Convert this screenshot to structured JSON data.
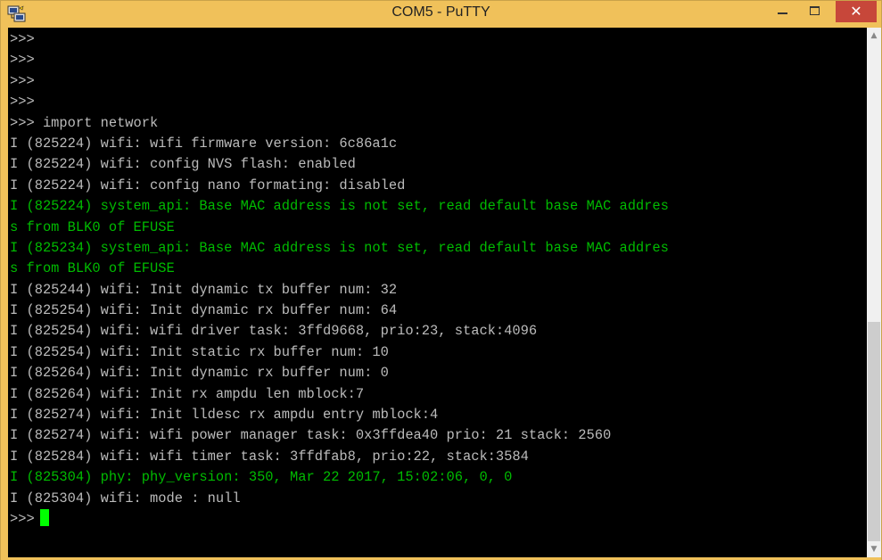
{
  "window": {
    "title": "COM5 - PuTTY",
    "icon": "putty-icon",
    "controls": {
      "minimize": "minimize-icon",
      "maximize": "maximize-icon",
      "close": "close-icon",
      "close_glyph": "✕"
    },
    "accent_color": "#f0c15a",
    "close_color": "#c7473a"
  },
  "terminal": {
    "background": "#000000",
    "text_color": "#bbbbbb",
    "info_color": "#00bb00",
    "cursor_color": "#00ff00",
    "lines": [
      {
        "text": ">>>",
        "color": "gray"
      },
      {
        "text": ">>>",
        "color": "gray"
      },
      {
        "text": ">>>",
        "color": "gray"
      },
      {
        "text": ">>>",
        "color": "gray"
      },
      {
        "text": ">>> import network",
        "color": "gray"
      },
      {
        "text": "I (825224) wifi: wifi firmware version: 6c86a1c",
        "color": "gray"
      },
      {
        "text": "I (825224) wifi: config NVS flash: enabled",
        "color": "gray"
      },
      {
        "text": "I (825224) wifi: config nano formating: disabled",
        "color": "gray"
      },
      {
        "text": "I (825224) system_api: Base MAC address is not set, read default base MAC addres",
        "color": "green"
      },
      {
        "text": "s from BLK0 of EFUSE",
        "color": "green"
      },
      {
        "text": "I (825234) system_api: Base MAC address is not set, read default base MAC addres",
        "color": "green"
      },
      {
        "text": "s from BLK0 of EFUSE",
        "color": "green"
      },
      {
        "text": "I (825244) wifi: Init dynamic tx buffer num: 32",
        "color": "gray"
      },
      {
        "text": "I (825254) wifi: Init dynamic rx buffer num: 64",
        "color": "gray"
      },
      {
        "text": "I (825254) wifi: wifi driver task: 3ffd9668, prio:23, stack:4096",
        "color": "gray"
      },
      {
        "text": "I (825254) wifi: Init static rx buffer num: 10",
        "color": "gray"
      },
      {
        "text": "I (825264) wifi: Init dynamic rx buffer num: 0",
        "color": "gray"
      },
      {
        "text": "I (825264) wifi: Init rx ampdu len mblock:7",
        "color": "gray"
      },
      {
        "text": "I (825274) wifi: Init lldesc rx ampdu entry mblock:4",
        "color": "gray"
      },
      {
        "text": "I (825274) wifi: wifi power manager task: 0x3ffdea40 prio: 21 stack: 2560",
        "color": "gray"
      },
      {
        "text": "I (825284) wifi: wifi timer task: 3ffdfab8, prio:22, stack:3584",
        "color": "gray"
      },
      {
        "text": "I (825304) phy: phy_version: 350, Mar 22 2017, 15:02:06, 0, 0",
        "color": "green"
      },
      {
        "text": "I (825304) wifi: mode : null",
        "color": "gray"
      }
    ],
    "prompt": ">>>"
  },
  "scrollbar": {
    "up_glyph": "▲",
    "down_glyph": "▼"
  }
}
